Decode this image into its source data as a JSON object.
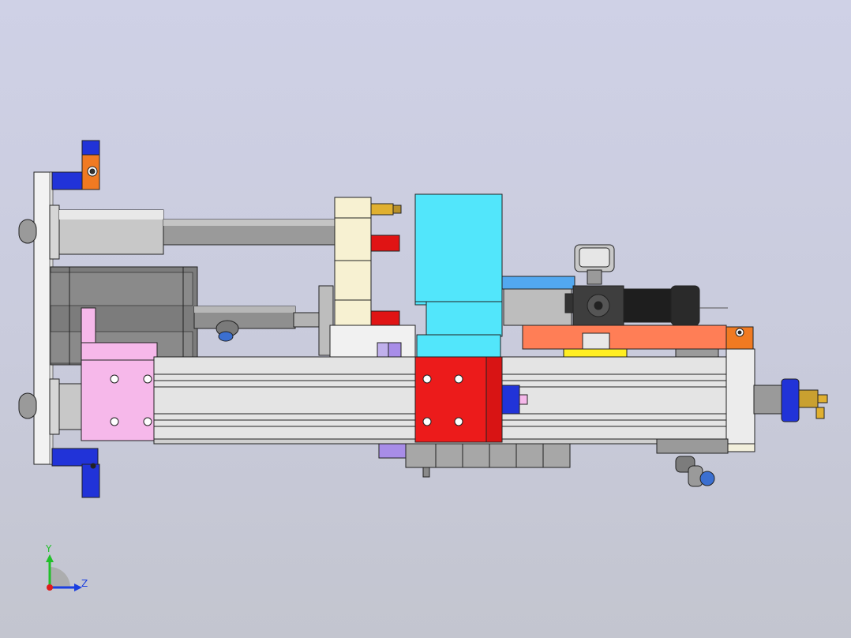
{
  "triad": {
    "y_label": "Y",
    "z_label": "Z",
    "y_color": "#22c02a",
    "z_color": "#1b3fe0",
    "x_color": "#e01b1b"
  },
  "colors": {
    "background_top": "#cfd1e6",
    "background_bottom": "#c3c5cf",
    "base_plate": "#f2f2f2",
    "bracket_blue": "#2133d8",
    "bracket_orange": "#f07a22",
    "cylinder_grey": "#c8c8c8",
    "rod_grey": "#9a9a9a",
    "motor_dark": "#7c7c7c",
    "pink_plate": "#f6b8ea",
    "rail_white": "#e4e4e4",
    "carriage_red": "#ec1b1b",
    "cyan_block": "#52e6fb",
    "cream_block": "#f7f1d2",
    "salmon_plate": "#ff7e56",
    "yellow_strip": "#ffee22",
    "gold_fitting": "#e0b030",
    "red_pin": "#e01414",
    "lavender_block": "#a88de8",
    "valve_grey": "#a7a7a7"
  }
}
